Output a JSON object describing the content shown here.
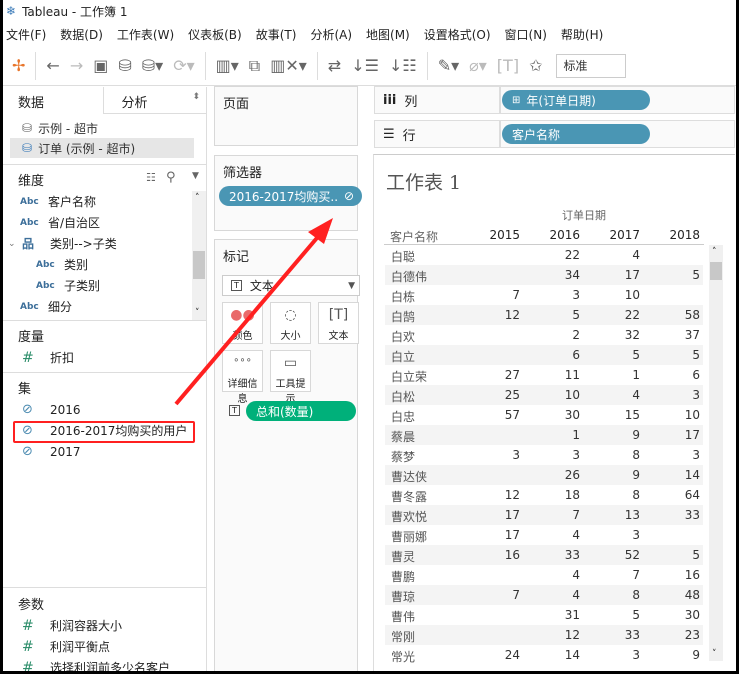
{
  "window": {
    "title": "Tableau - 工作簿 1"
  },
  "menu": [
    "文件(F)",
    "数据(D)",
    "工作表(W)",
    "仪表板(B)",
    "故事(T)",
    "分析(A)",
    "地图(M)",
    "设置格式(O)",
    "窗口(N)",
    "帮助(H)"
  ],
  "toolbar": {
    "fit_value": "标准"
  },
  "left": {
    "tabs": [
      "数据",
      "分析"
    ],
    "datasources": [
      "示例 - 超市",
      "订单 (示例 - 超市)"
    ],
    "dimensions_header": "维度",
    "dimensions": [
      {
        "label": "客户名称",
        "type": "Abc",
        "indent": 0
      },
      {
        "label": "省/自治区",
        "type": "Abc",
        "indent": 0
      },
      {
        "label": "类别-->子类",
        "type": "hierarchy",
        "indent": 0
      },
      {
        "label": "类别",
        "type": "Abc",
        "indent": 1
      },
      {
        "label": "子类别",
        "type": "Abc",
        "indent": 1
      },
      {
        "label": "细分",
        "type": "Abc",
        "indent": 0
      }
    ],
    "measures_header": "度量",
    "measures": [
      "折扣"
    ],
    "sets_header": "集",
    "sets": [
      "2016",
      "2016-2017均购买的用户",
      "2017"
    ],
    "params_header": "参数",
    "params": [
      "利润容器大小",
      "利润平衡点",
      "选择利润前多少名客户"
    ]
  },
  "cards": {
    "pages": "页面",
    "filters": "筛选器",
    "filter_pill": "2016-2017均购买..",
    "marks": "标记",
    "mark_type": "文本",
    "mark_buttons": [
      "颜色",
      "大小",
      "文本",
      "详细信息",
      "工具提示"
    ],
    "text_pill": "总和(数量)"
  },
  "shelves": {
    "columns_label": "列",
    "columns_pill": "年(订单日期)",
    "rows_label": "行",
    "rows_pill": "客户名称"
  },
  "sheet": {
    "title": "工作表 1",
    "col_group": "订单日期",
    "row_header": "客户名称",
    "years": [
      "2015",
      "2016",
      "2017",
      "2018"
    ],
    "rows": [
      [
        "白聪",
        "",
        "22",
        "4",
        ""
      ],
      [
        "白德伟",
        "",
        "34",
        "17",
        "5"
      ],
      [
        "白栋",
        "7",
        "3",
        "10",
        ""
      ],
      [
        "白鹄",
        "12",
        "5",
        "22",
        "58"
      ],
      [
        "白欢",
        "",
        "2",
        "32",
        "37"
      ],
      [
        "白立",
        "",
        "6",
        "5",
        "5"
      ],
      [
        "白立荣",
        "27",
        "11",
        "1",
        "6"
      ],
      [
        "白松",
        "25",
        "10",
        "4",
        "3"
      ],
      [
        "白忠",
        "57",
        "30",
        "15",
        "10"
      ],
      [
        "蔡晨",
        "",
        "1",
        "9",
        "17"
      ],
      [
        "蔡梦",
        "3",
        "3",
        "8",
        "3"
      ],
      [
        "曹达侠",
        "",
        "26",
        "9",
        "14"
      ],
      [
        "曹冬露",
        "12",
        "18",
        "8",
        "64"
      ],
      [
        "曹欢悦",
        "17",
        "7",
        "13",
        "33"
      ],
      [
        "曹丽娜",
        "17",
        "4",
        "3",
        ""
      ],
      [
        "曹灵",
        "16",
        "33",
        "52",
        "5"
      ],
      [
        "曹鹏",
        "",
        "4",
        "7",
        "16"
      ],
      [
        "曹琼",
        "7",
        "4",
        "8",
        "48"
      ],
      [
        "曹伟",
        "",
        "31",
        "5",
        "30"
      ],
      [
        "常刚",
        "",
        "12",
        "33",
        "23"
      ],
      [
        "常光",
        "24",
        "14",
        "3",
        "9"
      ]
    ]
  },
  "colors": {
    "pill_blue": "#4a96b4",
    "pill_green": "#00b07a",
    "annotation_red": "#ff2020"
  }
}
